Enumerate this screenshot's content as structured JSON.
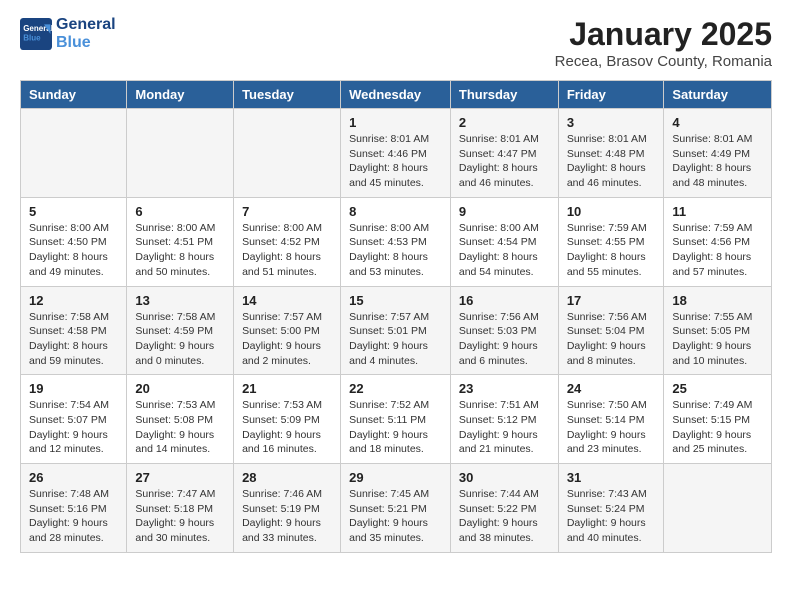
{
  "header": {
    "logo_general": "General",
    "logo_blue": "Blue",
    "month_title": "January 2025",
    "location": "Recea, Brasov County, Romania"
  },
  "days_of_week": [
    "Sunday",
    "Monday",
    "Tuesday",
    "Wednesday",
    "Thursday",
    "Friday",
    "Saturday"
  ],
  "weeks": [
    [
      {
        "day": "",
        "info": ""
      },
      {
        "day": "",
        "info": ""
      },
      {
        "day": "",
        "info": ""
      },
      {
        "day": "1",
        "info": "Sunrise: 8:01 AM\nSunset: 4:46 PM\nDaylight: 8 hours\nand 45 minutes."
      },
      {
        "day": "2",
        "info": "Sunrise: 8:01 AM\nSunset: 4:47 PM\nDaylight: 8 hours\nand 46 minutes."
      },
      {
        "day": "3",
        "info": "Sunrise: 8:01 AM\nSunset: 4:48 PM\nDaylight: 8 hours\nand 46 minutes."
      },
      {
        "day": "4",
        "info": "Sunrise: 8:01 AM\nSunset: 4:49 PM\nDaylight: 8 hours\nand 48 minutes."
      }
    ],
    [
      {
        "day": "5",
        "info": "Sunrise: 8:00 AM\nSunset: 4:50 PM\nDaylight: 8 hours\nand 49 minutes."
      },
      {
        "day": "6",
        "info": "Sunrise: 8:00 AM\nSunset: 4:51 PM\nDaylight: 8 hours\nand 50 minutes."
      },
      {
        "day": "7",
        "info": "Sunrise: 8:00 AM\nSunset: 4:52 PM\nDaylight: 8 hours\nand 51 minutes."
      },
      {
        "day": "8",
        "info": "Sunrise: 8:00 AM\nSunset: 4:53 PM\nDaylight: 8 hours\nand 53 minutes."
      },
      {
        "day": "9",
        "info": "Sunrise: 8:00 AM\nSunset: 4:54 PM\nDaylight: 8 hours\nand 54 minutes."
      },
      {
        "day": "10",
        "info": "Sunrise: 7:59 AM\nSunset: 4:55 PM\nDaylight: 8 hours\nand 55 minutes."
      },
      {
        "day": "11",
        "info": "Sunrise: 7:59 AM\nSunset: 4:56 PM\nDaylight: 8 hours\nand 57 minutes."
      }
    ],
    [
      {
        "day": "12",
        "info": "Sunrise: 7:58 AM\nSunset: 4:58 PM\nDaylight: 8 hours\nand 59 minutes."
      },
      {
        "day": "13",
        "info": "Sunrise: 7:58 AM\nSunset: 4:59 PM\nDaylight: 9 hours\nand 0 minutes."
      },
      {
        "day": "14",
        "info": "Sunrise: 7:57 AM\nSunset: 5:00 PM\nDaylight: 9 hours\nand 2 minutes."
      },
      {
        "day": "15",
        "info": "Sunrise: 7:57 AM\nSunset: 5:01 PM\nDaylight: 9 hours\nand 4 minutes."
      },
      {
        "day": "16",
        "info": "Sunrise: 7:56 AM\nSunset: 5:03 PM\nDaylight: 9 hours\nand 6 minutes."
      },
      {
        "day": "17",
        "info": "Sunrise: 7:56 AM\nSunset: 5:04 PM\nDaylight: 9 hours\nand 8 minutes."
      },
      {
        "day": "18",
        "info": "Sunrise: 7:55 AM\nSunset: 5:05 PM\nDaylight: 9 hours\nand 10 minutes."
      }
    ],
    [
      {
        "day": "19",
        "info": "Sunrise: 7:54 AM\nSunset: 5:07 PM\nDaylight: 9 hours\nand 12 minutes."
      },
      {
        "day": "20",
        "info": "Sunrise: 7:53 AM\nSunset: 5:08 PM\nDaylight: 9 hours\nand 14 minutes."
      },
      {
        "day": "21",
        "info": "Sunrise: 7:53 AM\nSunset: 5:09 PM\nDaylight: 9 hours\nand 16 minutes."
      },
      {
        "day": "22",
        "info": "Sunrise: 7:52 AM\nSunset: 5:11 PM\nDaylight: 9 hours\nand 18 minutes."
      },
      {
        "day": "23",
        "info": "Sunrise: 7:51 AM\nSunset: 5:12 PM\nDaylight: 9 hours\nand 21 minutes."
      },
      {
        "day": "24",
        "info": "Sunrise: 7:50 AM\nSunset: 5:14 PM\nDaylight: 9 hours\nand 23 minutes."
      },
      {
        "day": "25",
        "info": "Sunrise: 7:49 AM\nSunset: 5:15 PM\nDaylight: 9 hours\nand 25 minutes."
      }
    ],
    [
      {
        "day": "26",
        "info": "Sunrise: 7:48 AM\nSunset: 5:16 PM\nDaylight: 9 hours\nand 28 minutes."
      },
      {
        "day": "27",
        "info": "Sunrise: 7:47 AM\nSunset: 5:18 PM\nDaylight: 9 hours\nand 30 minutes."
      },
      {
        "day": "28",
        "info": "Sunrise: 7:46 AM\nSunset: 5:19 PM\nDaylight: 9 hours\nand 33 minutes."
      },
      {
        "day": "29",
        "info": "Sunrise: 7:45 AM\nSunset: 5:21 PM\nDaylight: 9 hours\nand 35 minutes."
      },
      {
        "day": "30",
        "info": "Sunrise: 7:44 AM\nSunset: 5:22 PM\nDaylight: 9 hours\nand 38 minutes."
      },
      {
        "day": "31",
        "info": "Sunrise: 7:43 AM\nSunset: 5:24 PM\nDaylight: 9 hours\nand 40 minutes."
      },
      {
        "day": "",
        "info": ""
      }
    ]
  ]
}
